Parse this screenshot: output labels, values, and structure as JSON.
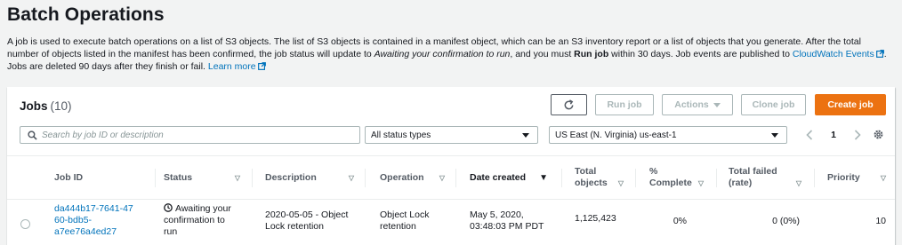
{
  "page": {
    "title": "Batch Operations",
    "intro": {
      "p1": "A job is used to execute batch operations on a list of S3 objects. The list of S3 objects is contained in a manifest object, which can be an S3 inventory report or a list of objects that you generate. After the total number of objects listed in the manifest has been confirmed, the job status will update to ",
      "awaiting": "Awaiting your confirmation to run",
      "p2": ", and you must ",
      "run_job": "Run job",
      "p3": " within 30 days. Job events are published to ",
      "cloudwatch_link": "CloudWatch Events",
      "p4": ". Jobs are deleted 90 days after they finish or fail. ",
      "learn_more": "Learn more"
    }
  },
  "jobs": {
    "title": "Jobs",
    "count": "(10)",
    "buttons": {
      "run_job": "Run job",
      "actions": "Actions",
      "clone_job": "Clone job",
      "create_job": "Create job"
    },
    "search_placeholder": "Search by job ID or description",
    "status_filter": "All status types",
    "region": "US East (N. Virginia) us-east-1",
    "page_number": "1",
    "columns": {
      "job_id": "Job ID",
      "status": "Status",
      "description": "Description",
      "operation": "Operation",
      "date_created": "Date created",
      "total_objects_1": "Total",
      "total_objects_2": "objects",
      "percent_complete_1": "%",
      "percent_complete_2": "Complete",
      "total_failed_1": "Total failed",
      "total_failed_2": "(rate)",
      "priority": "Priority"
    },
    "rows": [
      {
        "job_id_1": "da444b17-7641-47",
        "job_id_2": "60-bdb5-",
        "job_id_3": "a7ee76a4ed27",
        "status_1": "Awaiting your",
        "status_2": "confirmation to",
        "status_3": "run",
        "description_1": "2020-05-05 - Object",
        "description_2": "Lock retention",
        "operation_1": "Object Lock",
        "operation_2": "retention",
        "date_1": "May 5, 2020,",
        "date_2": "03:48:03 PM PDT",
        "total_objects": "1,125,423",
        "percent_complete": "0%",
        "total_failed": "0 (0%)",
        "priority": "10"
      }
    ]
  },
  "colors": {
    "accent": "#ec7211",
    "link": "#0073bb",
    "text": "#16191f",
    "muted": "#545b64",
    "background": "#f2f3f3"
  },
  "icons": {
    "refresh": "refresh-icon",
    "search": "search-icon",
    "settings": "gear-icon",
    "external": "external-link-icon",
    "clock": "clock-icon"
  }
}
